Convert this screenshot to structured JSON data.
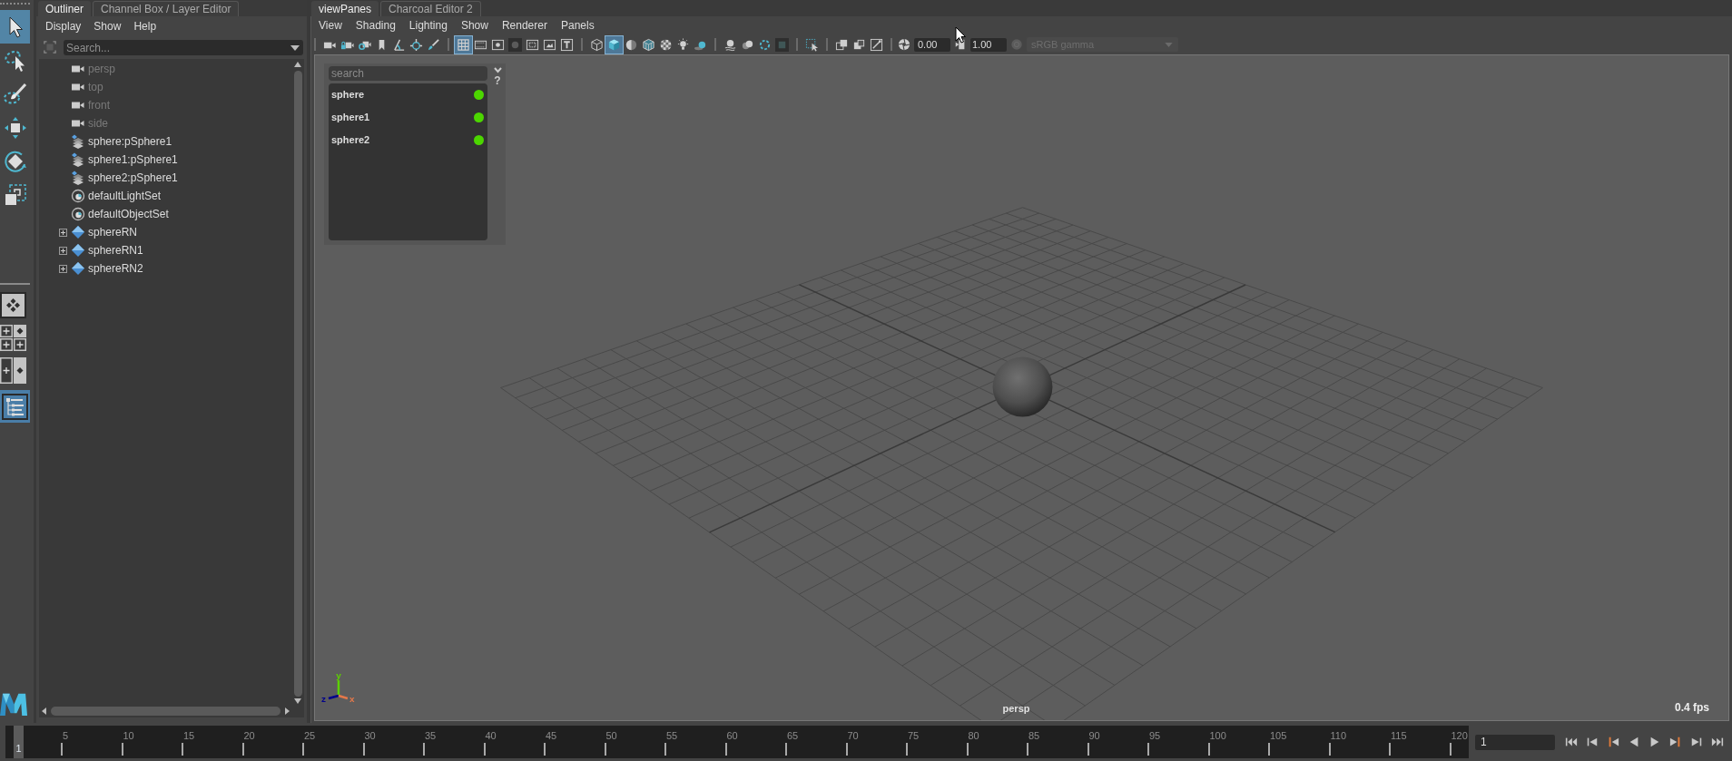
{
  "toolbox": {
    "tools": [
      {
        "kind": "select",
        "selected": true
      },
      {
        "kind": "lasso",
        "selected": false
      },
      {
        "kind": "paint",
        "selected": false
      },
      {
        "kind": "move",
        "selected": false
      },
      {
        "kind": "rotate",
        "selected": false
      },
      {
        "kind": "scale",
        "selected": false
      }
    ],
    "layouts": [
      {
        "kind": "single",
        "selected": false
      },
      {
        "kind": "four",
        "selected": false
      },
      {
        "kind": "two",
        "selected": false
      },
      {
        "kind": "list-pane",
        "selected": true
      }
    ]
  },
  "outliner": {
    "tabs": [
      {
        "label": "Outliner",
        "selected": true
      },
      {
        "label": "Channel Box / Layer Editor",
        "selected": false
      }
    ],
    "menu": [
      "Display",
      "Show",
      "Help"
    ],
    "search": {
      "placeholder": "Search..."
    },
    "items": [
      {
        "label": "persp",
        "kind": "camera",
        "dimmed": true
      },
      {
        "label": "top",
        "kind": "camera",
        "dimmed": true
      },
      {
        "label": "front",
        "kind": "camera",
        "dimmed": true
      },
      {
        "label": "side",
        "kind": "camera",
        "dimmed": true
      },
      {
        "label": "sphere:pSphere1",
        "kind": "transform",
        "dimmed": false
      },
      {
        "label": "sphere1:pSphere1",
        "kind": "transform",
        "dimmed": false
      },
      {
        "label": "sphere2:pSphere1",
        "kind": "transform",
        "dimmed": false
      },
      {
        "label": "defaultLightSet",
        "kind": "set",
        "dimmed": false
      },
      {
        "label": "defaultObjectSet",
        "kind": "set",
        "dimmed": false
      },
      {
        "label": "sphereRN",
        "kind": "reference",
        "dimmed": false,
        "expanded": false
      },
      {
        "label": "sphereRN1",
        "kind": "reference",
        "dimmed": false,
        "expanded": false
      },
      {
        "label": "sphereRN2",
        "kind": "reference",
        "dimmed": false,
        "expanded": false
      }
    ]
  },
  "view_panes": {
    "tabs": [
      {
        "label": "viewPanes",
        "selected": true
      },
      {
        "label": "Charcoal Editor 2",
        "selected": false
      }
    ],
    "menu": [
      "View",
      "Shading",
      "Lighting",
      "Show",
      "Renderer",
      "Panels"
    ],
    "toolbar": {
      "groups": [
        [
          {
            "kind": "camera",
            "selected": false
          },
          {
            "kind": "camera-lock",
            "selected": false
          },
          {
            "kind": "camera-gear",
            "selected": false
          },
          {
            "kind": "bookmark",
            "selected": false
          },
          {
            "kind": "angle",
            "selected": false
          },
          {
            "kind": "crosshair",
            "selected": false
          },
          {
            "kind": "brush",
            "selected": false
          }
        ],
        [
          {
            "kind": "grid",
            "selected": true
          },
          {
            "kind": "film-strip",
            "selected": false
          },
          {
            "kind": "dot-frame",
            "selected": false
          },
          {
            "kind": "circle-tile",
            "selected": false
          },
          {
            "kind": "nested-frame",
            "selected": false
          },
          {
            "kind": "picture-frame",
            "selected": false
          },
          {
            "kind": "t-frame",
            "selected": false
          }
        ],
        [
          {
            "kind": "wire-cube",
            "selected": false
          },
          {
            "kind": "shaded-cube",
            "selected": true
          },
          {
            "kind": "half-circle",
            "selected": false
          },
          {
            "kind": "textured-cube",
            "selected": false
          },
          {
            "kind": "checker",
            "selected": false
          },
          {
            "kind": "light-bulb",
            "selected": false
          },
          {
            "kind": "sphere-shadow",
            "selected": false
          }
        ],
        [
          {
            "kind": "sphere-lines",
            "selected": false
          },
          {
            "kind": "double-circle",
            "selected": false
          },
          {
            "kind": "dashed-ring",
            "selected": false
          },
          {
            "kind": "square-tile",
            "selected": false
          }
        ],
        [
          {
            "kind": "select-box",
            "selected": false
          }
        ],
        [
          {
            "kind": "overlap-squares",
            "selected": false
          },
          {
            "kind": "layered-squares",
            "selected": false
          },
          {
            "kind": "framed-diagonal",
            "selected": false
          }
        ]
      ],
      "exposure": "0.00",
      "gamma": "1.00",
      "view_transform": {
        "value": "sRGB gamma",
        "disabled": true
      }
    },
    "viewport": {
      "selector": {
        "placeholder": "search",
        "help": "?",
        "items": [
          {
            "label": "sphere",
            "color": "#4cd600"
          },
          {
            "label": "sphere1",
            "color": "#4cd600"
          },
          {
            "label": "sphere2",
            "color": "#4cd600"
          }
        ]
      },
      "axes": [
        {
          "label": "y",
          "color": "#5cd000"
        },
        {
          "label": "z",
          "color": "#00008c"
        },
        {
          "label": "x",
          "color": "#e4784a"
        }
      ],
      "camera": "persp",
      "fps": "0.4 fps"
    }
  },
  "timeline": {
    "level": 0,
    "current_frame": "1",
    "ticks": [
      "5",
      "10",
      "15",
      "20",
      "25",
      "30",
      "35",
      "40",
      "45",
      "50",
      "55",
      "60",
      "65",
      "70",
      "75",
      "80",
      "85",
      "90",
      "95",
      "100",
      "105",
      "110",
      "115",
      "120"
    ],
    "frame_field": "1"
  }
}
